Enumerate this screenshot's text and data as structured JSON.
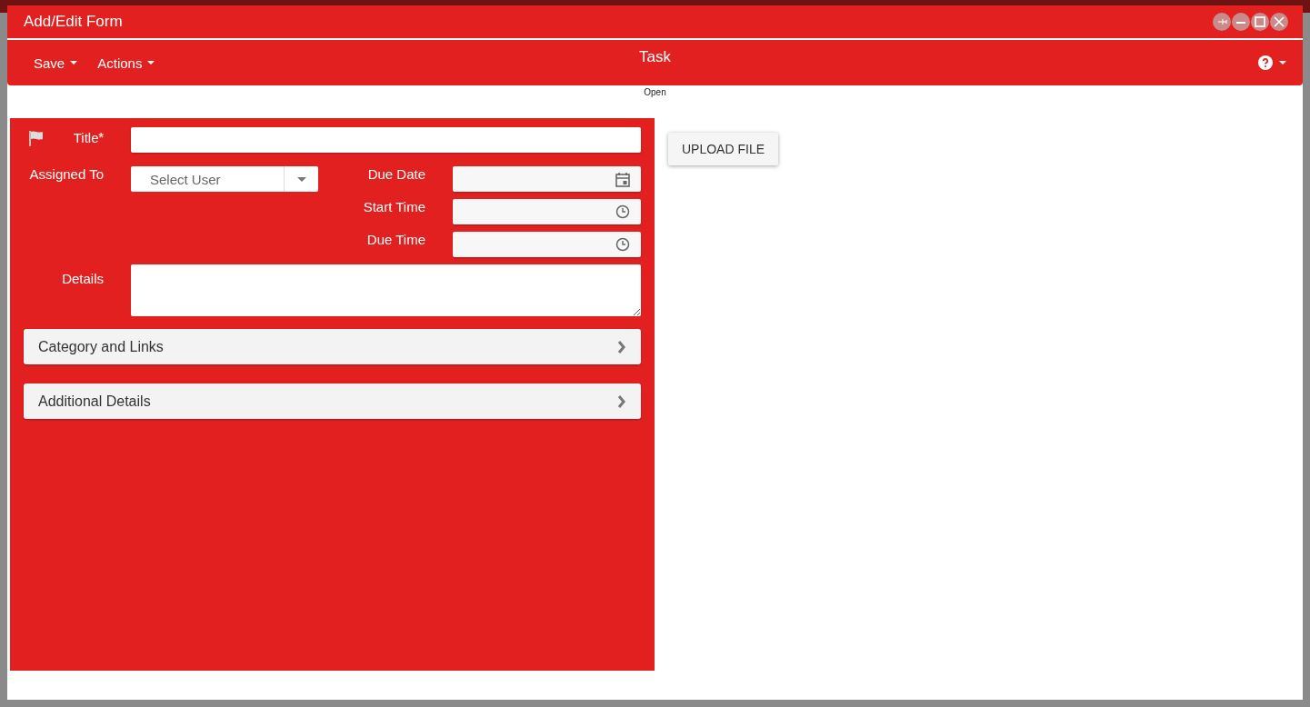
{
  "window": {
    "title": "Add/Edit Form",
    "controls": [
      {
        "kind": "pin"
      },
      {
        "kind": "minimize"
      },
      {
        "kind": "maximize"
      },
      {
        "kind": "close"
      }
    ]
  },
  "toolbar": {
    "menus": [
      {
        "label": "Save"
      },
      {
        "label": "Actions"
      }
    ],
    "title": "Task",
    "status": "Open"
  },
  "form": {
    "fields": [
      {
        "kind": "text",
        "label": "Title",
        "required_mark": "*"
      },
      {
        "kind": "select",
        "label": "Assigned To",
        "placeholder": "Select User"
      },
      {
        "kind": "date",
        "label": "Due Date"
      },
      {
        "kind": "time",
        "label": "Start Time"
      },
      {
        "kind": "time",
        "label": "Due Time"
      },
      {
        "kind": "textarea",
        "label": "Details"
      }
    ],
    "sections": [
      {
        "label": "Category and Links",
        "expanded": false
      },
      {
        "label": "Additional Details",
        "expanded": false
      }
    ]
  },
  "upload_button": {
    "label": "UPLOAD FILE"
  }
}
